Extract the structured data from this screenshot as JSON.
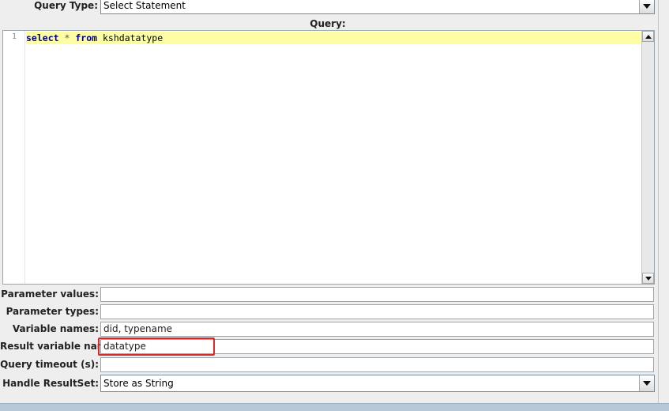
{
  "query_type": {
    "label": "Query Type:",
    "selected": "Select Statement"
  },
  "query": {
    "label": "Query:",
    "line_number": "1",
    "code": {
      "kw_select": "select",
      "star": "*",
      "kw_from": "from",
      "table": "kshdatatype"
    }
  },
  "fields": {
    "parameter_values": {
      "label": "Parameter values:",
      "value": ""
    },
    "parameter_types": {
      "label": "Parameter types:",
      "value": ""
    },
    "variable_names": {
      "label": "Variable names:",
      "value": "did, typename"
    },
    "result_variable_name": {
      "label": "Result variable name:",
      "value": "datatype"
    },
    "query_timeout": {
      "label": "Query timeout (s):",
      "value": ""
    },
    "handle_resultset": {
      "label": "Handle ResultSet:",
      "selected": "Store as String"
    }
  },
  "colors": {
    "highlight_box": "#d62a2a",
    "keyword": "#00007f",
    "current_line": "#fdfda3"
  }
}
